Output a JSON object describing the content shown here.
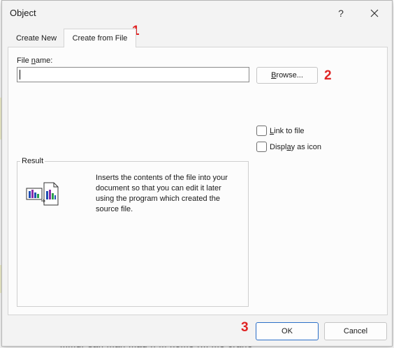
{
  "background": {
    "text": "mmur san man mau n m nome rm me crane"
  },
  "dialog": {
    "title": "Object",
    "help_label": "?",
    "tabs": [
      {
        "label": "Create New",
        "active": false
      },
      {
        "label": "Create from File",
        "active": true
      }
    ],
    "file_name": {
      "label_pre": "File ",
      "label_accel": "n",
      "label_post": "ame:",
      "value": "",
      "placeholder": ""
    },
    "browse": {
      "accel": "B",
      "rest": "rowse..."
    },
    "checkboxes": [
      {
        "accel": "L",
        "rest": "ink to file",
        "checked": false
      },
      {
        "pre": "Displ",
        "accel": "a",
        "rest": "y as icon",
        "checked": false
      }
    ],
    "result": {
      "legend": "Result",
      "text": "Inserts the contents of the file into your document so that you can edit it later using the program which created the source file."
    },
    "ok_label": "OK",
    "cancel_label": "Cancel",
    "markers": [
      "1",
      "2",
      "3"
    ],
    "colors": {
      "marker": "#e02424",
      "ok_border": "#2b6fc8",
      "dialog_bg": "#f3f3f3",
      "panel_bg": "#fcfcfc"
    }
  }
}
